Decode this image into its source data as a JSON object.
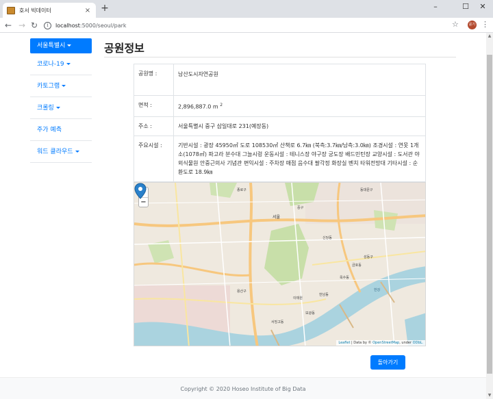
{
  "browser": {
    "tab_title": "호서 빅데이터",
    "tab_close": "×",
    "new_tab": "+",
    "url_host": "localhost",
    "url_path": ":5000/seoul/park",
    "window_controls": [
      "–",
      "☐",
      "✕"
    ],
    "avatar_text": "윤기"
  },
  "sidebar": {
    "active": "서울특별시",
    "items": [
      {
        "label": "코로나-19",
        "dropdown": true
      },
      {
        "label": "카토그램",
        "dropdown": true
      },
      {
        "label": "크롤링",
        "dropdown": true
      },
      {
        "label": "주가 예측",
        "dropdown": false
      },
      {
        "label": "워드 클라우드",
        "dropdown": true
      }
    ]
  },
  "main": {
    "title": "공원정보",
    "rows": [
      {
        "label": "공원명 :",
        "value": "남산도시자연공원"
      },
      {
        "label": "면적 :",
        "value": "2,896,887.0 m",
        "sup": "2"
      },
      {
        "label": "주소 :",
        "value": "서울특별시 중구 삼일대로 231(예장동)"
      },
      {
        "label": "주요시설 :",
        "value": "기반시설 : 광장 45950㎡ 도로 108530㎡ 산책로 6.7㎞ (북측:3.7㎞/남측:3.0㎞) 조경시설 : 연못 1개소(1078㎡) 파고라 분수대 그늘시렁 운동시설 : 테니스장 야구장 궁도장 배드민턴장 교양시설 : 도서관 야외식물원 안중근의사 기념관 편익시설 : 주차장 매점 음수대 팔각정 화장실 벤치 타워전망대 기타시설 : 순환도로 18.9㎞"
      }
    ],
    "back_button": "돌아가기"
  },
  "map": {
    "zoom_in": "+",
    "zoom_out": "−",
    "attribution_leaflet": "Leaflet",
    "attribution_text": " | Data by © ",
    "attribution_osm": "OpenStreetMap",
    "attribution_under": ", under ",
    "attribution_odbl": "ODbL.",
    "labels": [
      "서울",
      "중구",
      "용산구",
      "성동구",
      "한강",
      "이태원",
      "한남동",
      "동대문구",
      "종로구",
      "신당동",
      "옥수동",
      "금호동",
      "보광동",
      "서빙고동"
    ],
    "colors": {
      "land": "#efe9df",
      "park": "#c8dfa9",
      "water": "#aad3df",
      "primary": "#f7c77e",
      "secondary": "#f9e6a0",
      "urban": "#e6d5d0"
    }
  },
  "footer": {
    "text": "Copyright © 2020 Hoseo Institute of Big Data"
  }
}
